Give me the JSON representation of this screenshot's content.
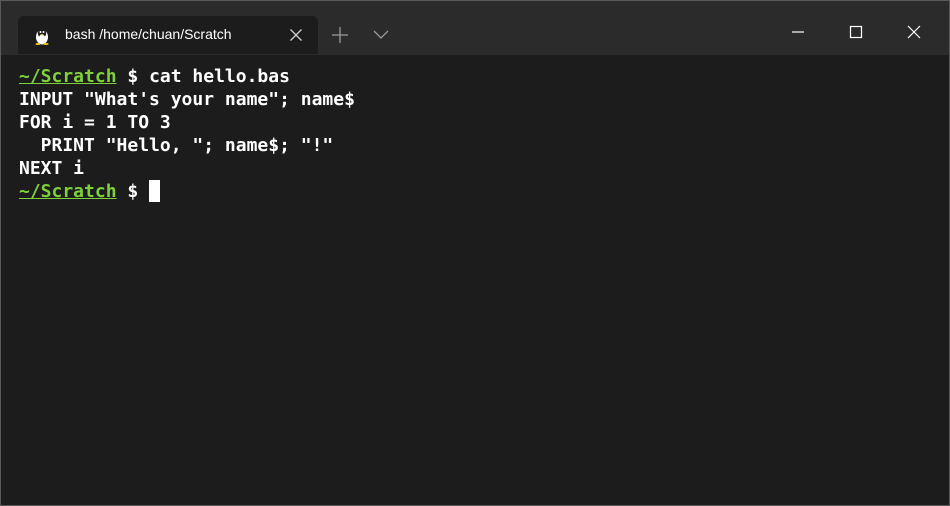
{
  "tab": {
    "title": "bash /home/chuan/Scratch",
    "icon": "linux-tux-icon"
  },
  "titlebar": {
    "new_tab_icon": "plus-icon",
    "dropdown_icon": "chevron-down-icon",
    "minimize_icon": "minimize-icon",
    "maximize_icon": "maximize-icon",
    "close_icon": "close-icon"
  },
  "terminal": {
    "prompt_path": "~/Scratch",
    "prompt_symbol": " $ ",
    "command": "cat hello.bas",
    "output": [
      "INPUT \"What's your name\"; name$",
      "FOR i = 1 TO 3",
      "  PRINT \"Hello, \"; name$; \"!\"",
      "NEXT i"
    ],
    "prompt_path_color": "#7fd13b",
    "background_color": "#1c1c1c"
  }
}
